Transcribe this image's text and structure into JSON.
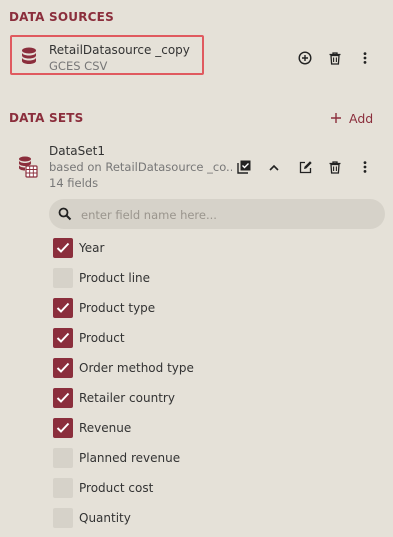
{
  "data_sources": {
    "title": "DATA SOURCES",
    "items": [
      {
        "name": "RetailDatasource _copy",
        "type": "GCES CSV"
      }
    ]
  },
  "data_sets": {
    "title": "DATA SETS",
    "add_label": "Add",
    "items": [
      {
        "name": "DataSet1",
        "based_on": "based on RetailDatasource _co...",
        "field_count": "14 fields"
      }
    ]
  },
  "search": {
    "placeholder": "enter field name here...",
    "value": ""
  },
  "fields": [
    {
      "label": "Year",
      "checked": true
    },
    {
      "label": "Product line",
      "checked": false
    },
    {
      "label": "Product type",
      "checked": true
    },
    {
      "label": "Product",
      "checked": true
    },
    {
      "label": "Order method type",
      "checked": true
    },
    {
      "label": "Retailer country",
      "checked": true
    },
    {
      "label": "Revenue",
      "checked": true
    },
    {
      "label": "Planned revenue",
      "checked": false
    },
    {
      "label": "Product cost",
      "checked": false
    },
    {
      "label": "Quantity",
      "checked": false
    }
  ],
  "colors": {
    "accent": "#8b2e3c",
    "highlight_border": "#e05a5f",
    "background": "#e5e1d8"
  }
}
